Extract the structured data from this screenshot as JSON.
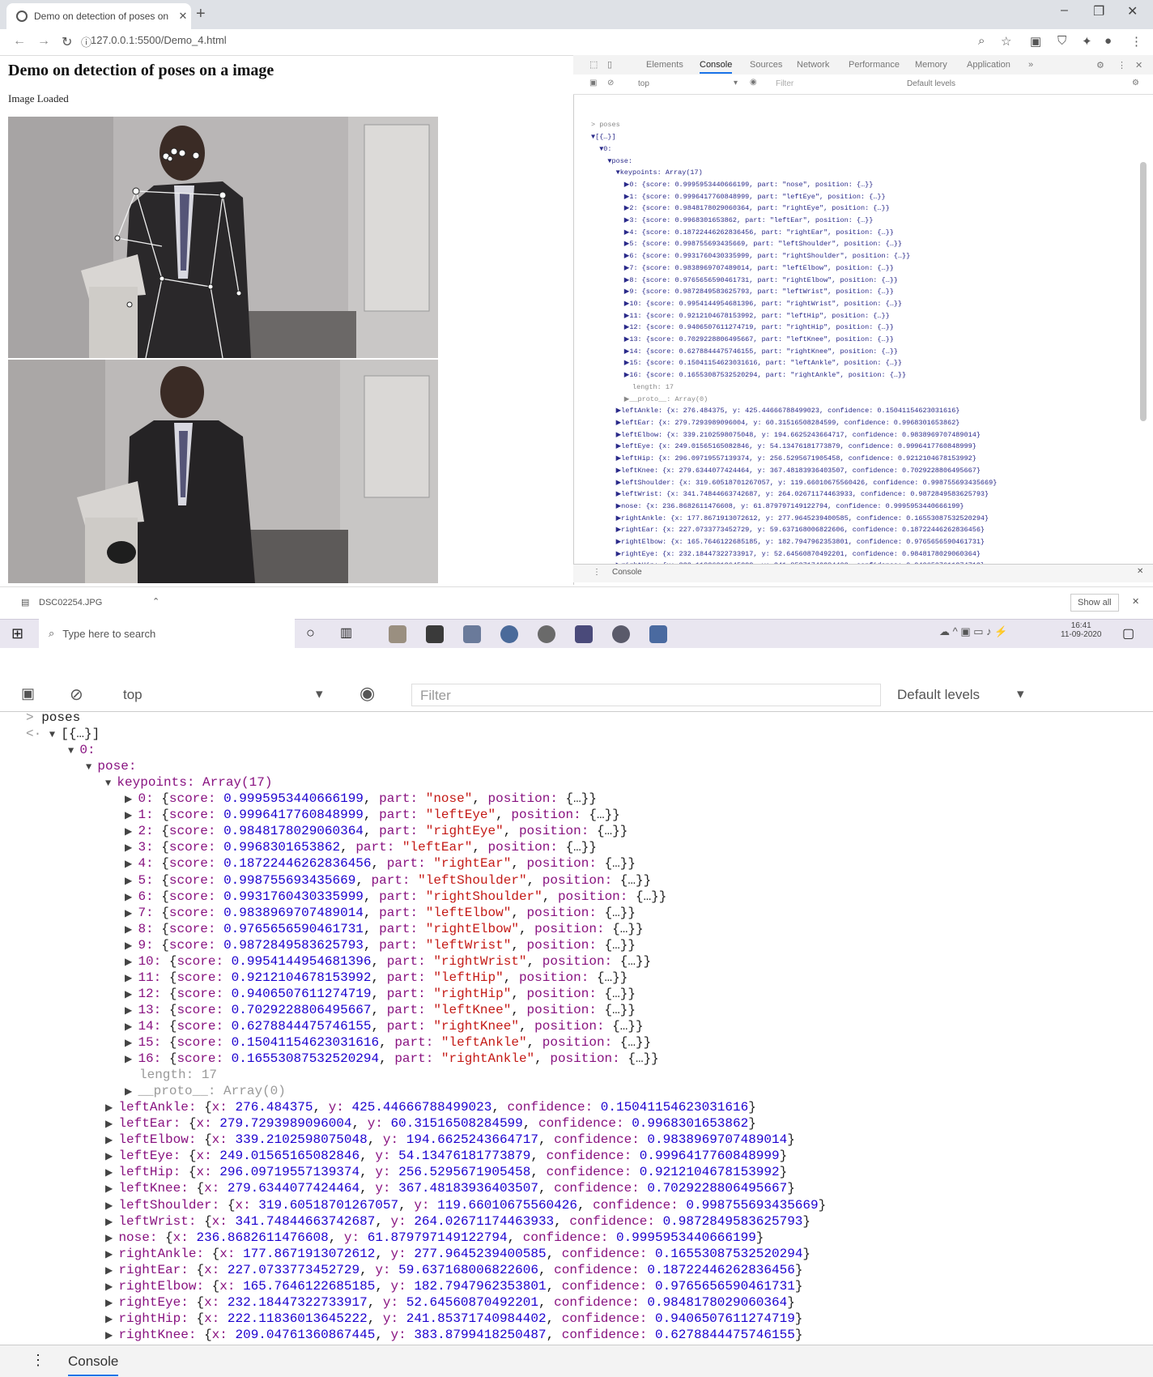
{
  "browser": {
    "tab_title": "Demo on detection of poses on",
    "url": "127.0.0.1:5500/Demo_4.html"
  },
  "page": {
    "title": "Demo on detection of poses on a image",
    "status": "Image Loaded"
  },
  "devtools": {
    "tabs": [
      "Elements",
      "Console",
      "Sources",
      "Network",
      "Performance",
      "Memory",
      "Application"
    ],
    "context": "top",
    "filter_placeholder": "Filter",
    "levels": "Default levels",
    "drawer_tab": "Console"
  },
  "downloads": {
    "file": "DSC02254.JPG",
    "show_all": "Show all"
  },
  "taskbar": {
    "search_placeholder": "Type here to search",
    "time": "16:41",
    "date": "11-09-2020"
  },
  "console": {
    "command": "poses",
    "result_summary": "[{…}]",
    "index_label": "0:",
    "pose_label": "pose:",
    "keypoints_label": "keypoints: Array(17)",
    "keypoints": [
      {
        "i": "0",
        "score": "0.9995953440666199",
        "part": "\"nose\""
      },
      {
        "i": "1",
        "score": "0.9996417760848999",
        "part": "\"leftEye\""
      },
      {
        "i": "2",
        "score": "0.9848178029060364",
        "part": "\"rightEye\""
      },
      {
        "i": "3",
        "score": "0.9968301653862",
        "part": "\"leftEar\""
      },
      {
        "i": "4",
        "score": "0.18722446262836456",
        "part": "\"rightEar\""
      },
      {
        "i": "5",
        "score": "0.998755693435669",
        "part": "\"leftShoulder\""
      },
      {
        "i": "6",
        "score": "0.9931760430335999",
        "part": "\"rightShoulder\""
      },
      {
        "i": "7",
        "score": "0.9838969707489014",
        "part": "\"leftElbow\""
      },
      {
        "i": "8",
        "score": "0.9765656590461731",
        "part": "\"rightElbow\""
      },
      {
        "i": "9",
        "score": "0.9872849583625793",
        "part": "\"leftWrist\""
      },
      {
        "i": "10",
        "score": "0.9954144954681396",
        "part": "\"rightWrist\""
      },
      {
        "i": "11",
        "score": "0.9212104678153992",
        "part": "\"leftHip\""
      },
      {
        "i": "12",
        "score": "0.9406507611274719",
        "part": "\"rightHip\""
      },
      {
        "i": "13",
        "score": "0.7029228806495667",
        "part": "\"leftKnee\""
      },
      {
        "i": "14",
        "score": "0.6278844475746155",
        "part": "\"rightKnee\""
      },
      {
        "i": "15",
        "score": "0.15041154623031616",
        "part": "\"leftAnkle\""
      },
      {
        "i": "16",
        "score": "0.16553087532520294",
        "part": "\"rightAnkle\""
      }
    ],
    "length_label": "length: 17",
    "proto_label": "__proto__: Array(0)",
    "parts": [
      {
        "name": "leftAnkle",
        "x": "276.484375",
        "y": "425.44666788499023",
        "c": "0.15041154623031616"
      },
      {
        "name": "leftEar",
        "x": "279.7293989096004",
        "y": "60.31516508284599",
        "c": "0.9968301653862"
      },
      {
        "name": "leftElbow",
        "x": "339.2102598075048",
        "y": "194.6625243664717",
        "c": "0.9838969707489014"
      },
      {
        "name": "leftEye",
        "x": "249.01565165082846",
        "y": "54.13476181773879",
        "c": "0.9996417760848999"
      },
      {
        "name": "leftHip",
        "x": "296.09719557139374",
        "y": "256.5295671905458",
        "c": "0.9212104678153992"
      },
      {
        "name": "leftKnee",
        "x": "279.6344077424464",
        "y": "367.48183936403507",
        "c": "0.7029228806495667"
      },
      {
        "name": "leftShoulder",
        "x": "319.60518701267057",
        "y": "119.66010675560426",
        "c": "0.998755693435669"
      },
      {
        "name": "leftWrist",
        "x": "341.74844663742687",
        "y": "264.02671174463933",
        "c": "0.9872849583625793"
      },
      {
        "name": "nose",
        "x": "236.8682611476608",
        "y": "61.879797149122794",
        "c": "0.9995953440666199"
      },
      {
        "name": "rightAnkle",
        "x": "177.8671913072612",
        "y": "277.9645239400585",
        "c": "0.16553087532520294"
      },
      {
        "name": "rightEar",
        "x": "227.0733773452729",
        "y": "59.637168006822606",
        "c": "0.18722446262836456"
      },
      {
        "name": "rightElbow",
        "x": "165.7646122685185",
        "y": "182.7947962353801",
        "c": "0.9765656590461731"
      },
      {
        "name": "rightEye",
        "x": "232.18447322733917",
        "y": "52.64560870492201",
        "c": "0.9848178029060364"
      },
      {
        "name": "rightHip",
        "x": "222.11836013645222",
        "y": "241.85371740984402",
        "c": "0.9406507611274719"
      },
      {
        "name": "rightKnee",
        "x": "209.04761360867445",
        "y": "383.8799418250487",
        "c": "0.6278844475746155"
      }
    ],
    "footer_tab": "Console"
  }
}
